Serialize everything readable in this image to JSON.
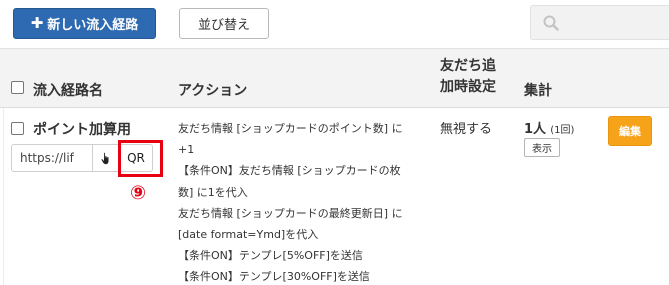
{
  "toolbar": {
    "new_route_label": "新しい流入経路",
    "sort_label": "並び替え",
    "search_placeholder": ""
  },
  "table": {
    "headers": {
      "name": "流入経路名",
      "action": "アクション",
      "friend_setting_line1": "友だち追",
      "friend_setting_line2": "加時設定",
      "count": "集計"
    },
    "rows": [
      {
        "name": "ポイント加算用",
        "url": "https://lif",
        "qr_label": "QR",
        "action_lines": [
          "友だち情報 [ショップカードのポイント数] に",
          "+1",
          "【条件ON】友だち情報 [ショップカードの枚",
          "数] に1を代入",
          "友だち情報 [ショップカードの最終更新日] に",
          "[date format=Ymd]を代入",
          "【条件ON】テンプレ[5%OFF]を送信",
          "【条件ON】テンプレ[30%OFF]を送信"
        ],
        "friend_setting": "無視する",
        "count_number": "1",
        "count_unit": "人",
        "count_detail": "(1回)",
        "show_label": "表示",
        "edit_label": "編集"
      }
    ]
  },
  "annotation": {
    "marker": "⑨",
    "color": "#e60012"
  },
  "colors": {
    "primary": "#2e6ab1",
    "edit": "#f6a31a",
    "header_bg": "#f3f3f3"
  }
}
